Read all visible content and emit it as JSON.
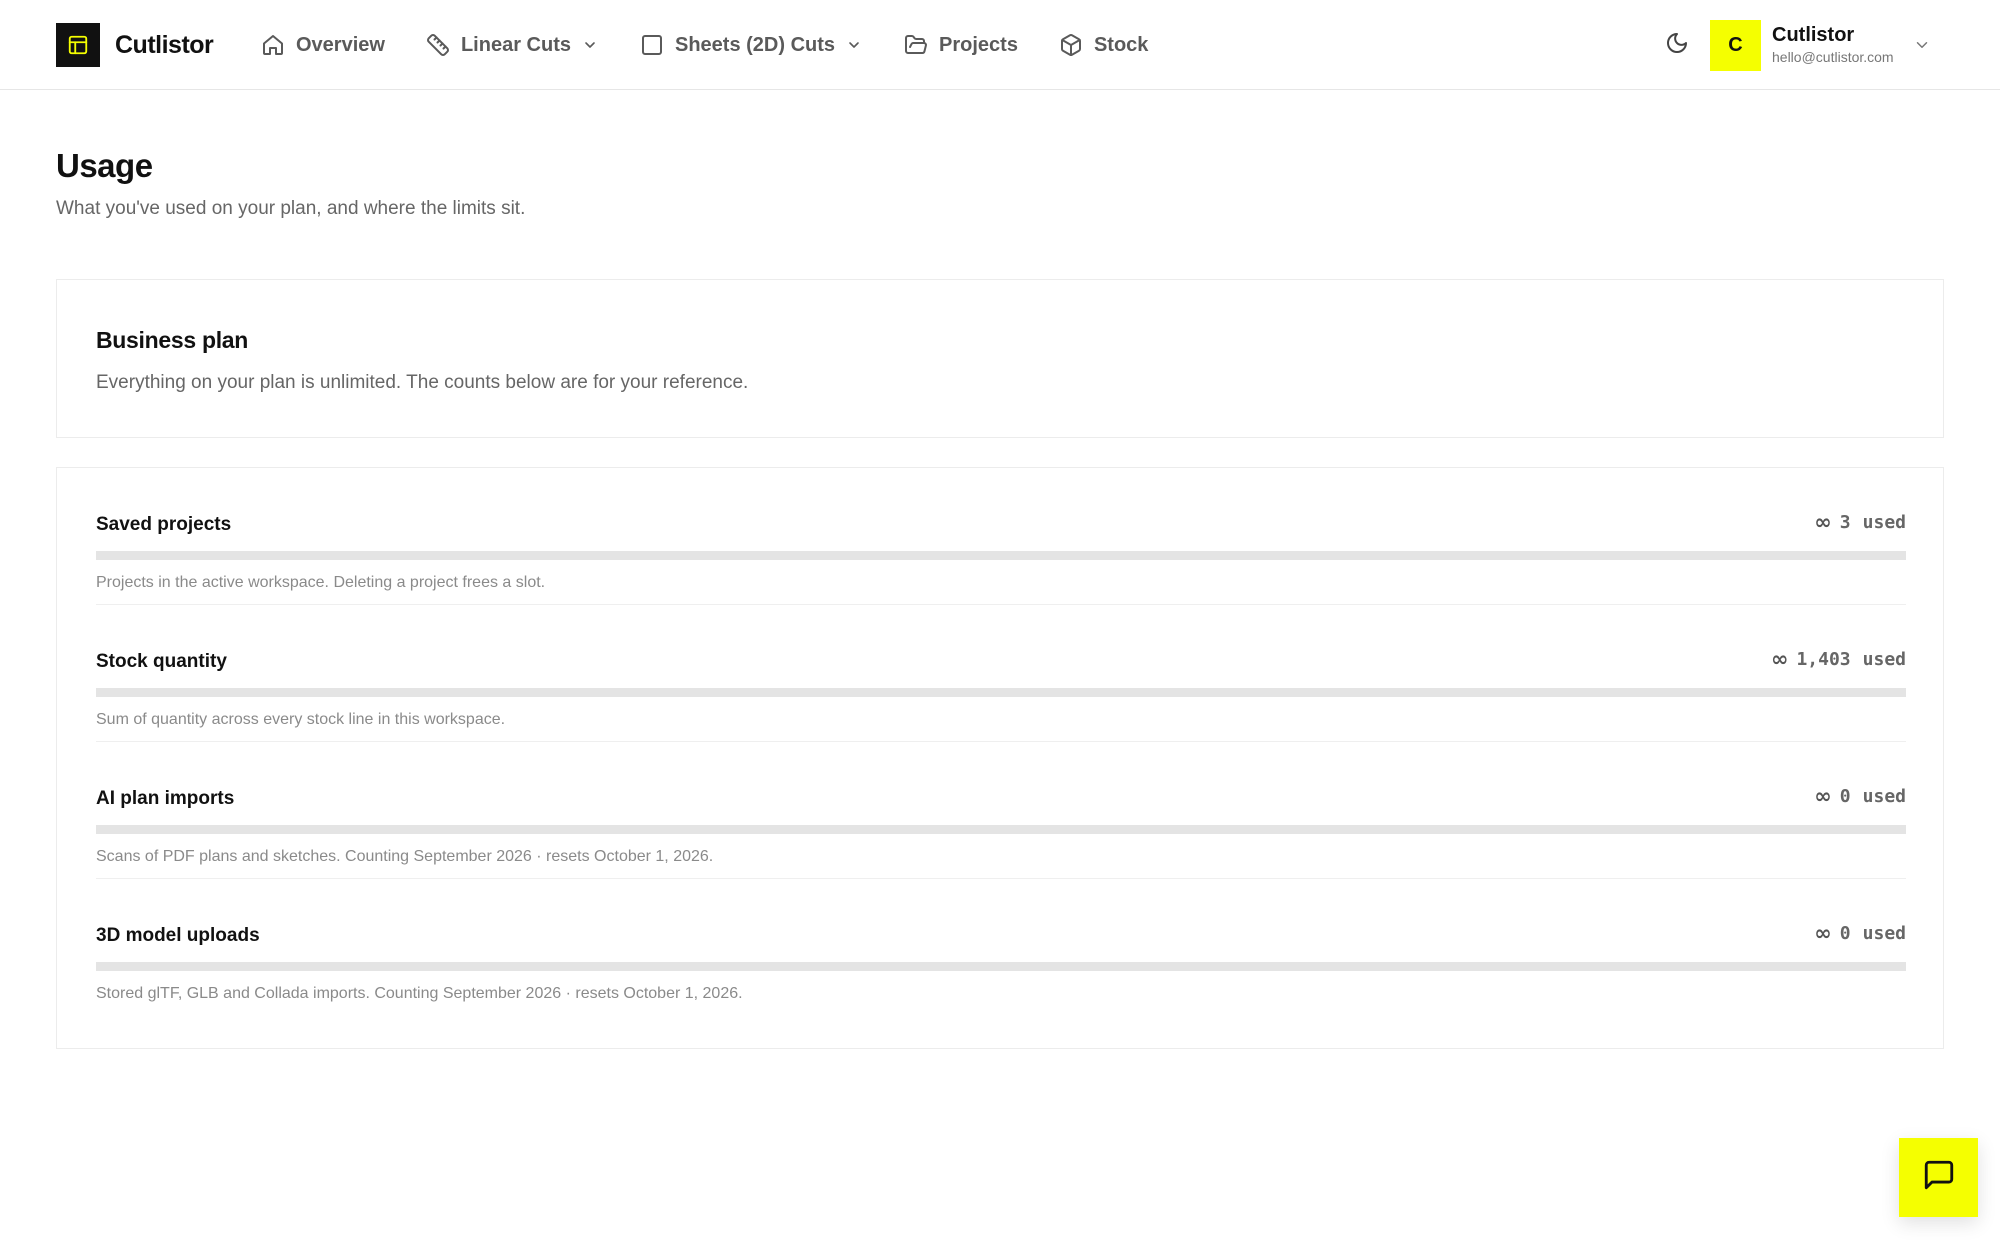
{
  "brand": {
    "name": "Cutlistor",
    "logo_icon": "layout-panel-icon"
  },
  "nav": {
    "items": [
      {
        "label": "Overview",
        "icon": "home-icon"
      },
      {
        "label": "Linear Cuts",
        "icon": "ruler-icon",
        "dropdown": true
      },
      {
        "label": "Sheets (2D) Cuts",
        "icon": "square-icon",
        "dropdown": true
      },
      {
        "label": "Projects",
        "icon": "folder-open-icon"
      },
      {
        "label": "Stock",
        "icon": "box-icon"
      }
    ]
  },
  "header": {
    "theme_icon": "moon-icon",
    "account": {
      "initial": "C",
      "name": "Cutlistor",
      "email": "hello@cutlistor.com"
    }
  },
  "page": {
    "title": "Usage",
    "subtitle": "What you've used on your plan, and where the limits sit."
  },
  "plan": {
    "title": "Business plan",
    "description": "Everything on your plan is unlimited. The counts below are for your reference."
  },
  "usage": [
    {
      "label": "Saved projects",
      "value": "3",
      "unit": "used",
      "limit_symbol": "∞",
      "note": "Projects in the active workspace. Deleting a project frees a slot.",
      "fill_fraction": 0
    },
    {
      "label": "Stock quantity",
      "value": "1,403",
      "unit": "used",
      "limit_symbol": "∞",
      "note": "Sum of quantity across every stock line in this workspace.",
      "fill_fraction": 0
    },
    {
      "label": "AI plan imports",
      "value": "0",
      "unit": "used",
      "limit_symbol": "∞",
      "note": "Scans of PDF plans and sketches. Counting September 2026 · resets October 1, 2026.",
      "fill_fraction": 0
    },
    {
      "label": "3D model uploads",
      "value": "0",
      "unit": "used",
      "limit_symbol": "∞",
      "note": "Stored glTF, GLB and Collada imports. Counting September 2026 · resets October 1, 2026.",
      "fill_fraction": 0
    }
  ],
  "chat": {
    "icon": "chat-bubble-icon"
  },
  "colors": {
    "accent": "#f5ff00",
    "ink": "#111111",
    "muted": "#666666",
    "track": "#e4e4e4"
  }
}
